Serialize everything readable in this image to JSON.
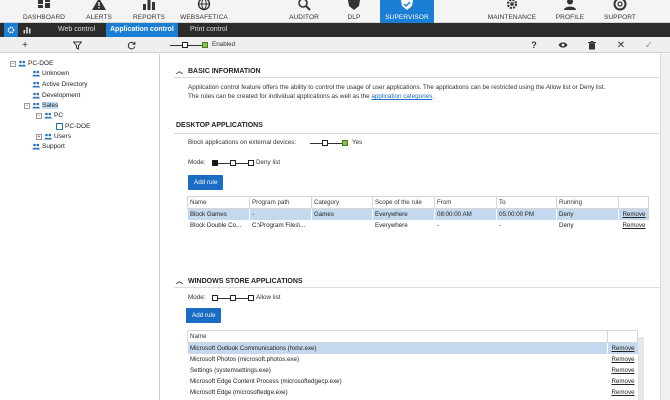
{
  "topnav": {
    "items": [
      {
        "label": "DASHBOARD",
        "icon": "dashboard-icon"
      },
      {
        "label": "ALERTS",
        "icon": "alert-triangle-icon"
      },
      {
        "label": "REPORTS",
        "icon": "chart-icon"
      },
      {
        "label": "WEBSAFETICA",
        "icon": "web-icon"
      },
      {
        "label": "AUDITOR",
        "icon": "auditor-icon"
      },
      {
        "label": "DLP",
        "icon": "shield-icon"
      },
      {
        "label": "SUPERVISOR",
        "icon": "supervisor-icon"
      },
      {
        "label": "MAINTENANCE",
        "icon": "gear-icon"
      },
      {
        "label": "PROFILE",
        "icon": "user-icon"
      },
      {
        "label": "SUPPORT",
        "icon": "lifebuoy-icon"
      }
    ],
    "active": "SUPERVISOR",
    "accent": "#1a7fd4"
  },
  "subtabs": {
    "items": [
      "Web control",
      "Application control",
      "Print control"
    ],
    "active": "Application control"
  },
  "toolbar": {
    "enabled_label": "Enabled"
  },
  "tree": {
    "nodes": [
      {
        "label": "PC-DOE"
      },
      {
        "label": "Unknown"
      },
      {
        "label": "Active Directory"
      },
      {
        "label": "Development"
      },
      {
        "label": "Sales"
      },
      {
        "label": "PC"
      },
      {
        "label": "PC-DOE"
      },
      {
        "label": "Users"
      },
      {
        "label": "Support"
      }
    ]
  },
  "basic": {
    "title": "BASIC INFORMATION",
    "text1": "Application control feature offers the ability to control the usage of user applications. The applications can be restricted using the Allow list or Deny list.",
    "text2": "The rules can be created for individual applications as well as the",
    "link": "application categories",
    "text3": "."
  },
  "desktop": {
    "title": "DESKTOP APPLICATIONS",
    "block_external_label": "Block applications on external devices:",
    "block_external_value": "Yes",
    "mode_label": "Mode:",
    "mode_value": "Deny list",
    "add_rule": "Add rule",
    "columns": [
      "Name",
      "Program path",
      "Category",
      "Scope of the rule",
      "From",
      "To",
      "Running",
      ""
    ],
    "rows": [
      [
        "Block Games",
        "-",
        "Games",
        "Everywhere",
        "08:00:00 AM",
        "05:00:00 PM",
        "Deny",
        "Remove"
      ],
      [
        "Block Double Co...",
        "C:\\Program Files\\...",
        "",
        "Everywhere",
        "-",
        "-",
        "Deny",
        "Remove"
      ]
    ]
  },
  "store": {
    "title": "WINDOWS STORE APPLICATIONS",
    "mode_label": "Mode:",
    "mode_value": "Allow list",
    "add_rule": "Add rule",
    "columns": [
      "Name",
      ""
    ],
    "rows": [
      [
        "Microsoft Outlook Communications (hxtsr.exe)",
        "Remove"
      ],
      [
        "Microsoft Photos (microsoft.photos.exe)",
        "Remove"
      ],
      [
        "Settings (systemsettings.exe)",
        "Remove"
      ],
      [
        "Microsoft Edge Content Process (microsoftedgecp.exe)",
        "Remove"
      ],
      [
        "Microsoft Edge (microsoftedge.exe)",
        "Remove"
      ]
    ]
  }
}
